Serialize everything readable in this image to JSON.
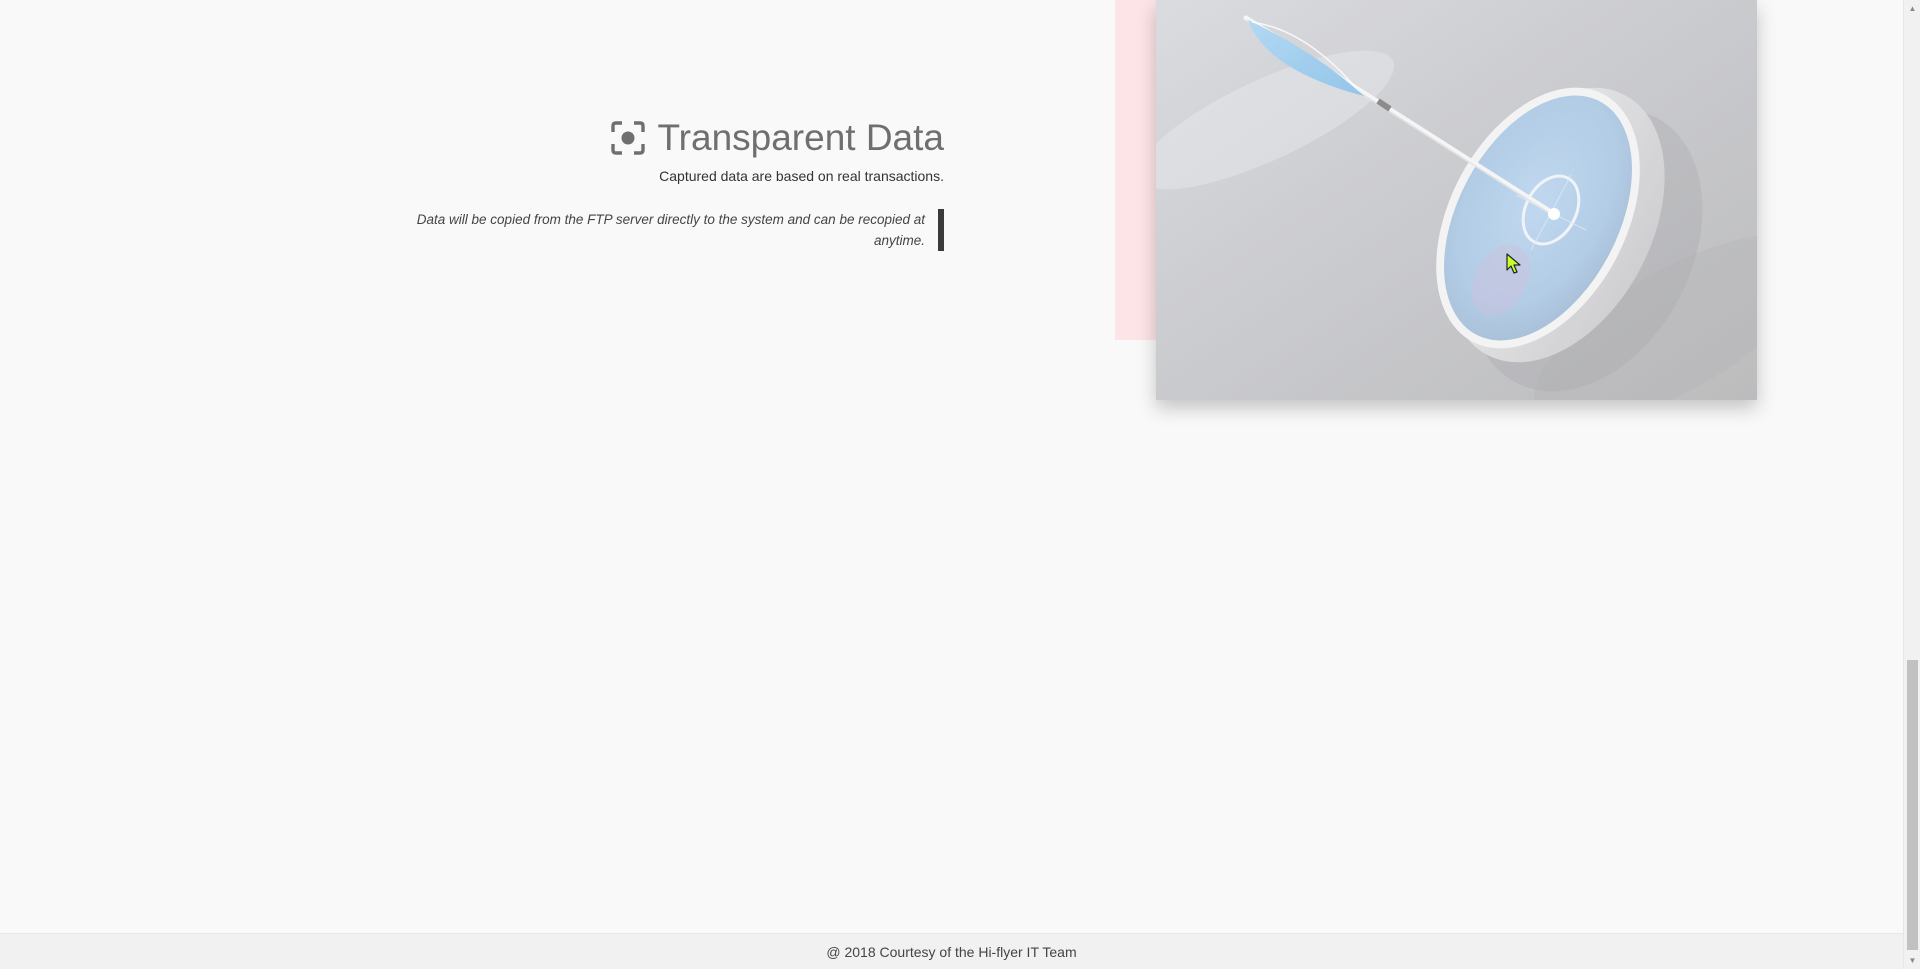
{
  "feature": {
    "icon": "focus-target-icon",
    "title": "Transparent Data",
    "subtitle": "Captured data are based on real transactions.",
    "quote": "Data will be copied from the FTP server directly to the system and can be recopied at anytime."
  },
  "image": {
    "subject": "arrow-in-target-image"
  },
  "footer": {
    "text": "@ 2018 Courtesy of the Hi-flyer IT Team"
  },
  "colors": {
    "background": "#f9f9f9",
    "title": "#6f6f6f",
    "accent_block": "#fce4e7",
    "quote_border": "#3a3a3a",
    "footer_bg": "#f1f1f1"
  }
}
